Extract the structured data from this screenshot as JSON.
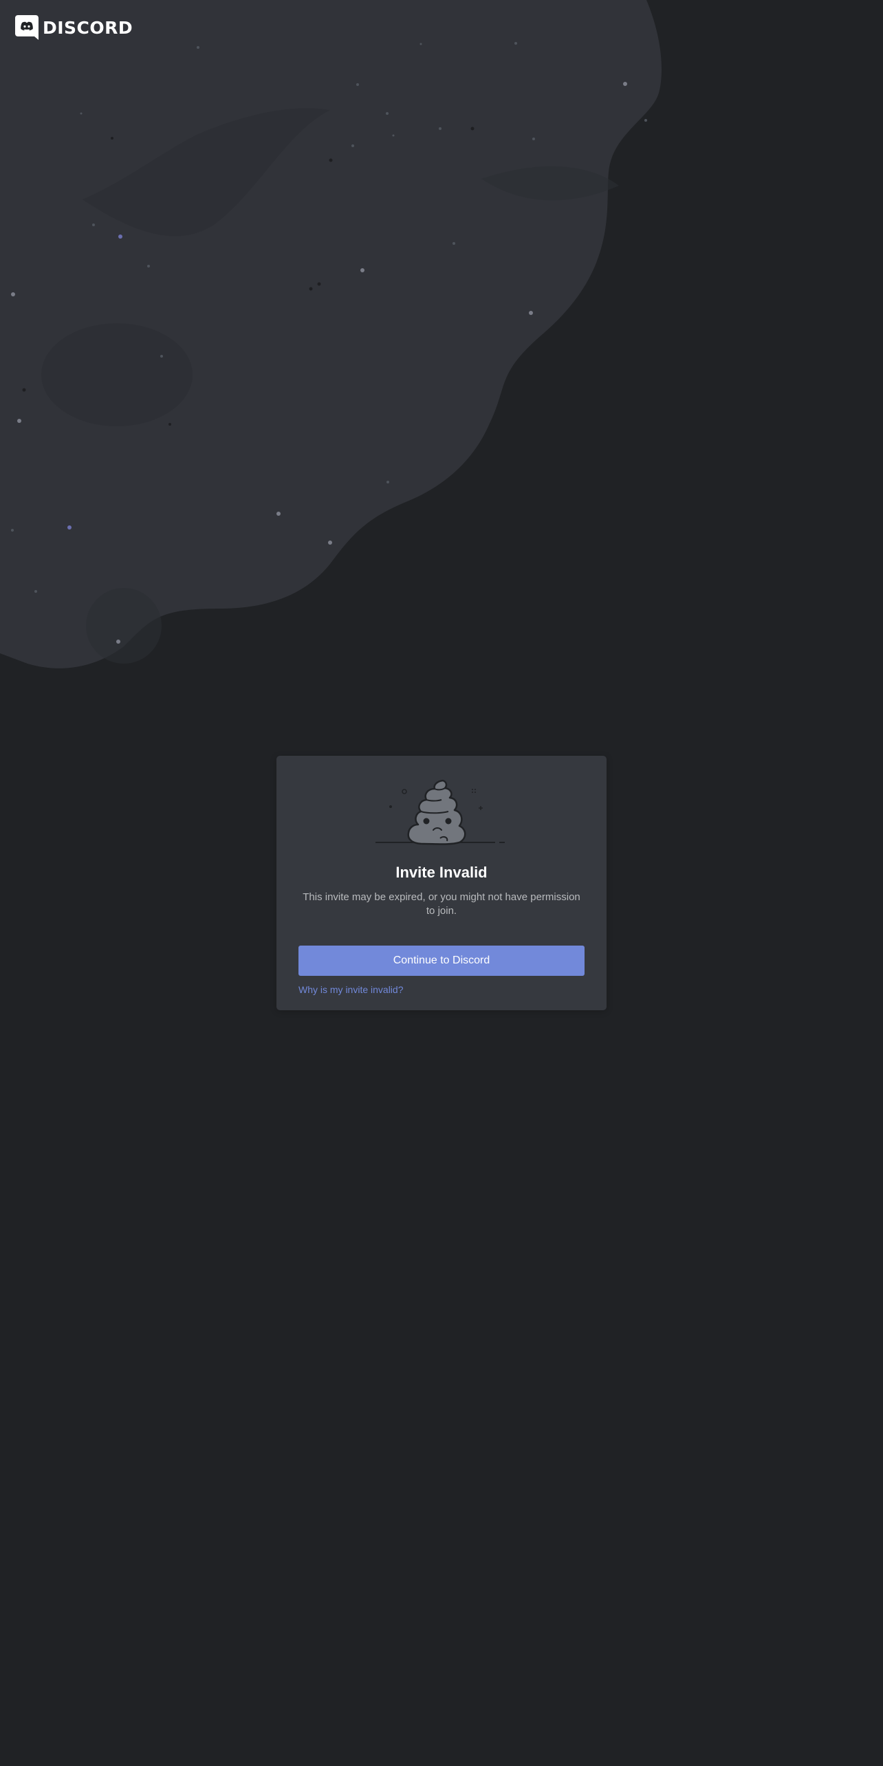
{
  "brand": {
    "logo_text": "DISCORD",
    "accent_color": "#7289da"
  },
  "card": {
    "title": "Invite Invalid",
    "description": "This invite may be expired, or you might not have permission to join.",
    "continue_label": "Continue to Discord",
    "help_link": "Why is my invite invalid?"
  },
  "icons": {
    "logo": "discord-logo-icon",
    "illustration": "sad-poop-illustration-icon"
  }
}
